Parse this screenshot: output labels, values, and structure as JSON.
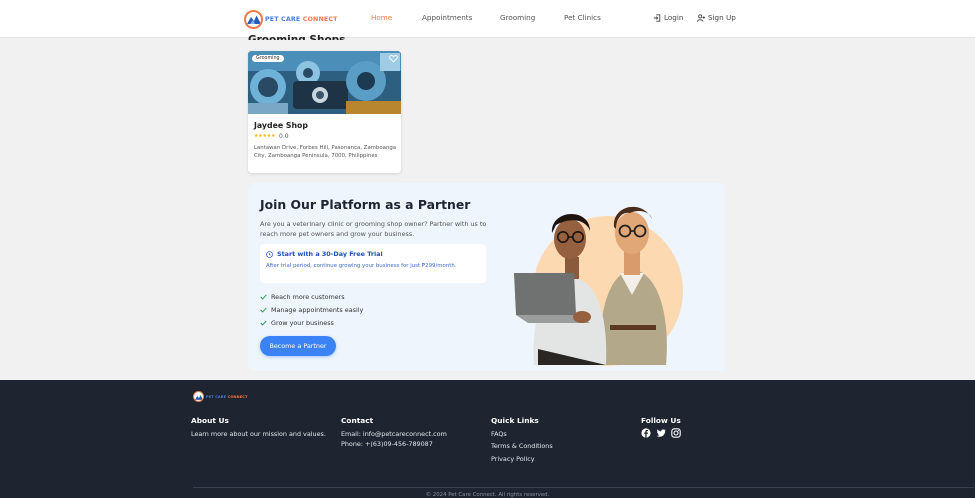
{
  "header": {
    "brand_primary": "PET CARE ",
    "brand_accent": "CONNECT",
    "nav": [
      {
        "label": "Home",
        "active": true
      },
      {
        "label": "Appointments",
        "active": false
      },
      {
        "label": "Grooming",
        "active": false
      },
      {
        "label": "Pet Clinics",
        "active": false
      }
    ],
    "login_label": "Login",
    "signup_label": "Sign Up"
  },
  "grooming": {
    "section_title": "Grooming Shops",
    "shop": {
      "badge": "Grooming",
      "name": "Jaydee Shop",
      "stars": "★★★★★",
      "rating": "0.0",
      "address": "Lantawan Drive, Forbes Hill, Pasonanca, Zamboanga City, Zamboanga Peninsula, 7000, Philippines"
    }
  },
  "partner": {
    "title": "Join Our Platform as a Partner",
    "description": "Are you a veterinary clinic or grooming shop owner? Partner with us to reach more pet owners and grow your business.",
    "trial_title": "Start with a 30-Day Free Trial",
    "trial_subtitle": "After trial period, continue growing your business for just ₱299/month.",
    "benefits": [
      "Reach more customers",
      "Manage appointments easily",
      "Grow your business"
    ],
    "button_label": "Become a Partner"
  },
  "footer": {
    "about_title": "About Us",
    "about_text": "Learn more about our mission and values.",
    "contact_title": "Contact",
    "email": "Email: info@petcareconnect.com",
    "phone": "Phone: +(63)09-456-789087",
    "links_title": "Quick Links",
    "links": [
      "FAQs",
      "Terms & Conditions",
      "Privacy Policy"
    ],
    "follow_title": "Follow Us",
    "social_icons": [
      "facebook-icon",
      "twitter-icon",
      "instagram-icon"
    ],
    "copyright": "© 2024 Pet Care Connect. All rights reserved."
  },
  "colors": {
    "accent": "#f07b4a",
    "primary": "#3b82f6",
    "footer_bg": "#1e2430",
    "partner_bg": "#eef5fd"
  }
}
